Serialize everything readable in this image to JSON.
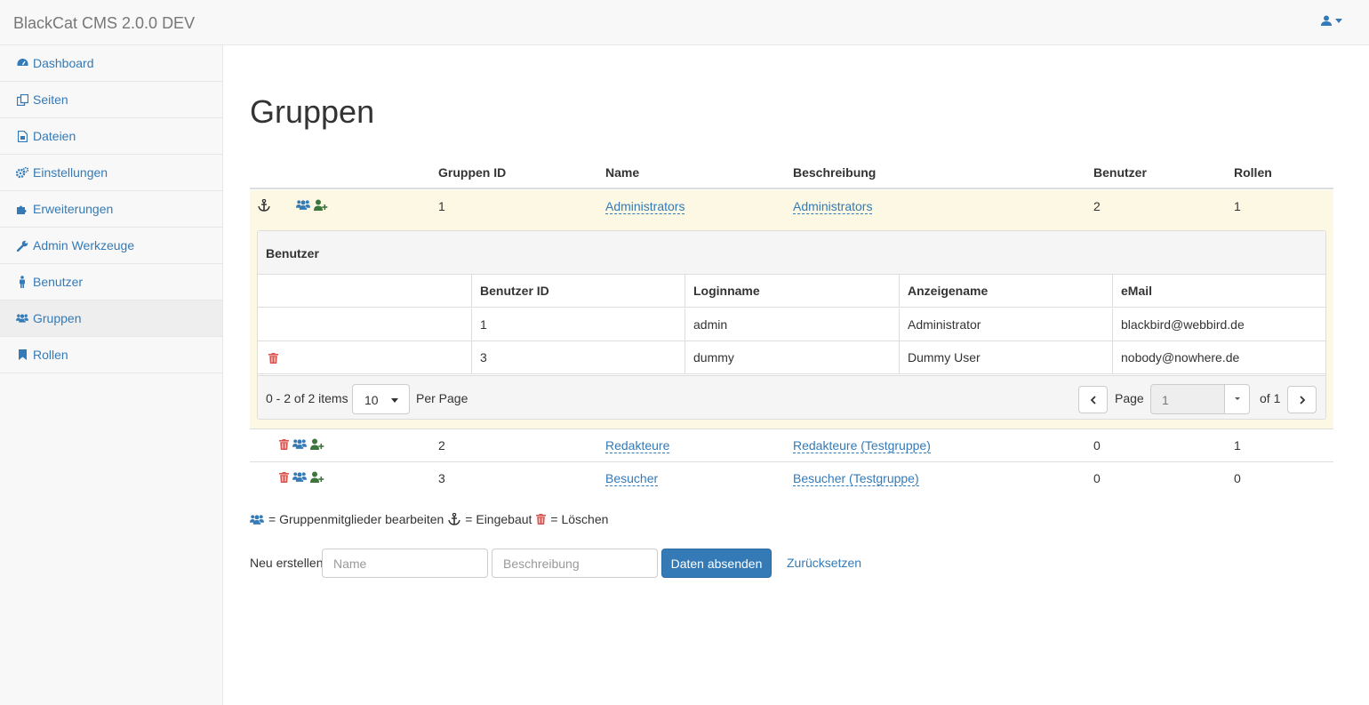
{
  "app": {
    "brand": "BlackCat CMS 2.0.0 DEV",
    "user_icon": "user-icon"
  },
  "sidebar": {
    "items": [
      {
        "label": "Dashboard",
        "icon": "dashboard-icon"
      },
      {
        "label": "Seiten",
        "icon": "pages-icon"
      },
      {
        "label": "Dateien",
        "icon": "files-icon"
      },
      {
        "label": "Einstellungen",
        "icon": "gears-icon"
      },
      {
        "label": "Erweiterungen",
        "icon": "puzzle-icon"
      },
      {
        "label": "Admin Werkzeuge",
        "icon": "wrench-icon"
      },
      {
        "label": "Benutzer",
        "icon": "person-icon"
      },
      {
        "label": "Gruppen",
        "icon": "users-icon",
        "active": true
      },
      {
        "label": "Rollen",
        "icon": "bookmark-icon"
      }
    ]
  },
  "page": {
    "title": "Gruppen"
  },
  "groups_table": {
    "headers": {
      "id": "Gruppen ID",
      "name": "Name",
      "desc": "Beschreibung",
      "users": "Benutzer",
      "roles": "Rollen"
    },
    "rows": [
      {
        "id": "1",
        "name": "Administrators",
        "desc": "Administrators",
        "users": "2",
        "roles": "1"
      },
      {
        "id": "2",
        "name": "Redakteure",
        "desc": "Redakteure (Testgruppe)",
        "users": "0",
        "roles": "1"
      },
      {
        "id": "3",
        "name": "Besucher",
        "desc": "Besucher (Testgruppe)",
        "users": "0",
        "roles": "0"
      }
    ]
  },
  "members_panel": {
    "title": "Benutzer",
    "headers": {
      "id": "Benutzer ID",
      "login": "Loginname",
      "display": "Anzeigename",
      "email": "eMail"
    },
    "rows": [
      {
        "id": "1",
        "login": "admin",
        "display": "Administrator",
        "email": "blackbird@webbird.de"
      },
      {
        "id": "3",
        "login": "dummy",
        "display": "Dummy User",
        "email": "nobody@nowhere.de"
      }
    ],
    "pager": {
      "items_text": "0 - 2 of 2 items",
      "per_page_value": "10",
      "per_page_label": "Per Page",
      "page_label": "Page",
      "page_value": "1",
      "of_label": "of 1"
    }
  },
  "legend": {
    "edit_members": "= Gruppenmitglieder bearbeiten",
    "builtin": "= Eingebaut",
    "delete": "= Löschen"
  },
  "new_form": {
    "label": "Neu erstellen",
    "name_placeholder": "Name",
    "desc_placeholder": "Beschreibung",
    "submit": "Daten absenden",
    "reset": "Zurücksetzen"
  },
  "colors": {
    "link": "#337ab7",
    "delete": "#d9534f",
    "add_user": "#3c763d",
    "selected_row": "#fcf8e3"
  }
}
